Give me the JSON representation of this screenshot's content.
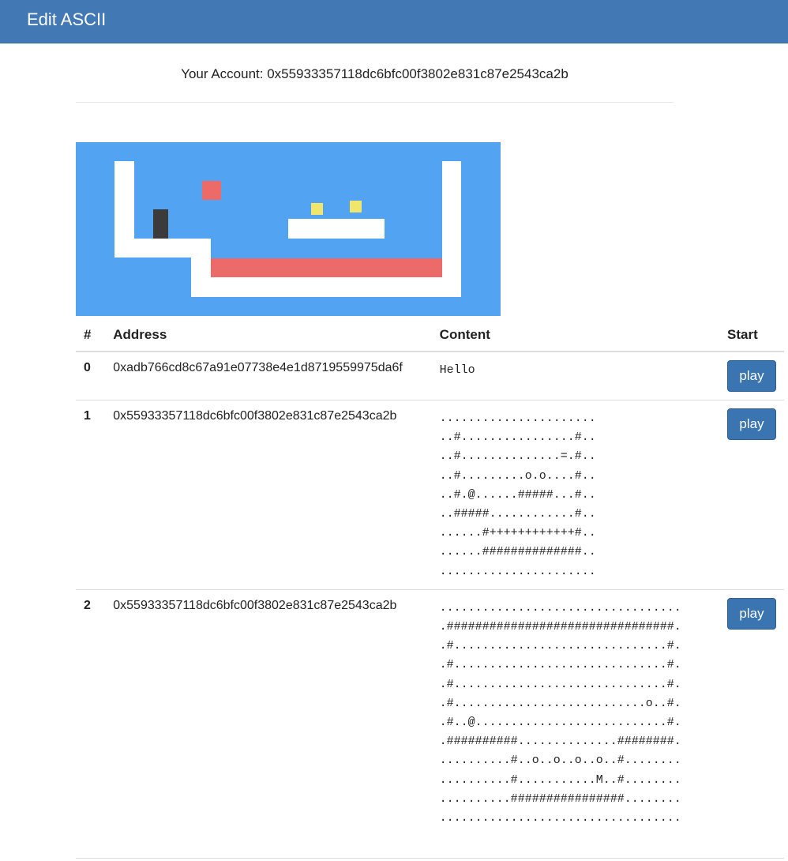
{
  "navbar": {
    "title": "Edit ASCII",
    "background": "#4279b5"
  },
  "account": {
    "text": "Your Account: 0x55933357118dc6bfc00f3802e831c87e2543ca2b"
  },
  "game_preview": {
    "background": "#52a3f2",
    "wall_color": "#ffffff",
    "lava_color": "#ec6a67",
    "coin_color": "#f1e56c",
    "player_color": "#3b3b3b"
  },
  "table": {
    "headers": {
      "num": "#",
      "address": "Address",
      "content": "Content",
      "start": "Start"
    },
    "rows": [
      {
        "num": "0",
        "address": "0xadb766cd8c67a91e07738e4e1d8719559975da6f",
        "content": "Hello",
        "button": "play"
      },
      {
        "num": "1",
        "address": "0x55933357118dc6bfc00f3802e831c87e2543ca2b",
        "content": "......................\n..#................#..\n..#..............=.#..\n..#.........o.o....#..\n..#.@......#####...#..\n..#####............#..\n......#++++++++++++#..\n......##############..\n......................",
        "button": "play"
      },
      {
        "num": "2",
        "address": "0x55933357118dc6bfc00f3802e831c87e2543ca2b",
        "content": "..................................\n.################################.\n.#..............................#.\n.#..............................#.\n.#..............................#.\n.#...........................o..#.\n.#..@...........................#.\n.##########..............########.\n..........#..o..o..o..o..#........\n..........#...........M..#........\n..........################........\n..................................",
        "button": "play"
      }
    ]
  }
}
